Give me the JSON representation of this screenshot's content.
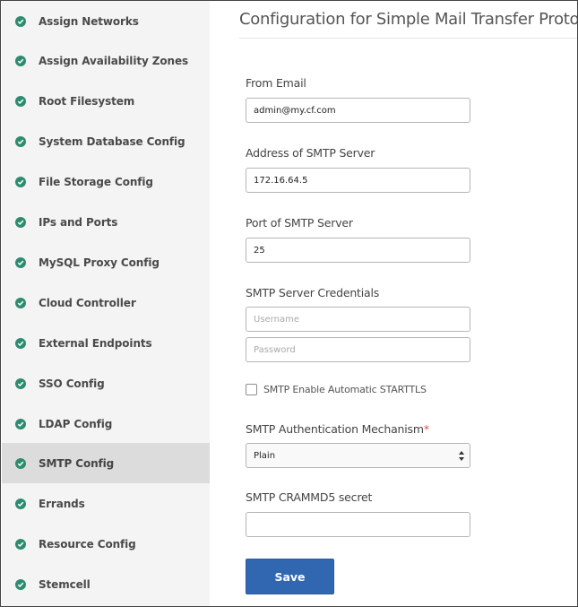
{
  "sidebar": {
    "items": [
      {
        "label": "Assign Networks",
        "icon": "check-circle-icon"
      },
      {
        "label": "Assign Availability Zones",
        "icon": "check-circle-icon"
      },
      {
        "label": "Root Filesystem",
        "icon": "check-circle-icon"
      },
      {
        "label": "System Database Config",
        "icon": "check-circle-icon"
      },
      {
        "label": "File Storage Config",
        "icon": "check-circle-icon"
      },
      {
        "label": "IPs and Ports",
        "icon": "check-circle-icon"
      },
      {
        "label": "MySQL Proxy Config",
        "icon": "check-circle-icon"
      },
      {
        "label": "Cloud Controller",
        "icon": "check-circle-icon"
      },
      {
        "label": "External Endpoints",
        "icon": "check-circle-icon"
      },
      {
        "label": "SSO Config",
        "icon": "check-circle-icon"
      },
      {
        "label": "LDAP Config",
        "icon": "check-circle-icon"
      },
      {
        "label": "SMTP Config",
        "icon": "check-circle-icon",
        "active": true
      },
      {
        "label": "Errands",
        "icon": "check-circle-icon"
      },
      {
        "label": "Resource Config",
        "icon": "check-circle-icon"
      },
      {
        "label": "Stemcell",
        "icon": "check-circle-icon"
      }
    ],
    "check_color": "#2d8c6f",
    "active_background": "#dcdcdc"
  },
  "main": {
    "title": "Configuration for Simple Mail Transfer Protocol",
    "from_email": {
      "label": "From Email",
      "value": "admin@my.cf.com"
    },
    "smtp_address": {
      "label": "Address of SMTP Server",
      "value": "172.16.64.5"
    },
    "smtp_port": {
      "label": "Port of SMTP Server",
      "value": "25"
    },
    "credentials": {
      "label": "SMTP Server Credentials",
      "username_placeholder": "Username",
      "password_placeholder": "Password"
    },
    "starttls": {
      "label": "SMTP Enable Automatic STARTTLS",
      "checked": false
    },
    "auth_mechanism": {
      "label": "SMTP Authentication Mechanism",
      "required_marker": "*",
      "selected": "Plain"
    },
    "crammd5": {
      "label": "SMTP CRAMMD5 secret",
      "value": ""
    },
    "save_label": "Save",
    "accent_color": "#3167b1"
  }
}
